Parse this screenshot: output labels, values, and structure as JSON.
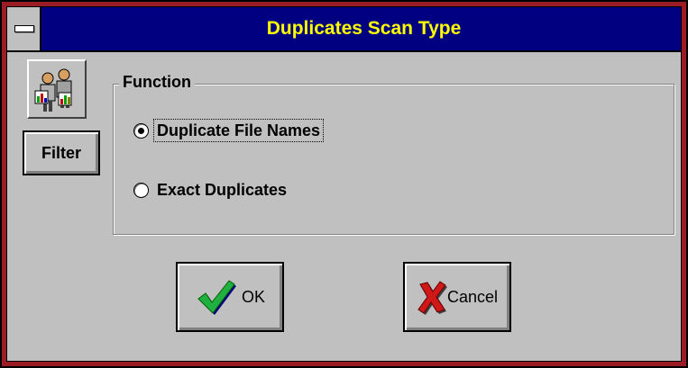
{
  "window": {
    "title": "Duplicates Scan Type",
    "title_color": "#ffff00",
    "titlebar_color": "#000080",
    "frame_color": "#9b1c24"
  },
  "sidebar": {
    "icon": "people-chart-icon",
    "filter_label": "Filter"
  },
  "function_group": {
    "label": "Function",
    "options": [
      {
        "label": "Duplicate File Names",
        "selected": true
      },
      {
        "label": "Exact Duplicates",
        "selected": false
      }
    ]
  },
  "buttons": {
    "ok_label": "OK",
    "ok_icon": "green-checkmark-icon",
    "cancel_label": "Cancel",
    "cancel_icon": "red-x-icon"
  }
}
